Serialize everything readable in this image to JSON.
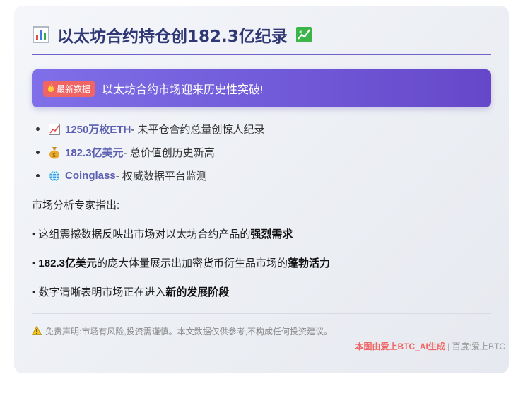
{
  "header": {
    "title": "以太坊合约持仓创182.3亿纪录",
    "left_icon": "bar-chart-icon",
    "right_icon": "chart-up-icon"
  },
  "banner": {
    "badge": "最新数据",
    "badge_icon": "fire-icon",
    "text": "以太坊合约市场迎来历史性突破!"
  },
  "points": [
    {
      "icon": "chart-up-icon",
      "highlight": "1250万枚ETH",
      "desc": " - 未平仓合约总量创惊人纪录"
    },
    {
      "icon": "money-bag-icon",
      "highlight": "182.3亿美元",
      "desc": " - 总价值创历史新高"
    },
    {
      "icon": "globe-icon",
      "highlight": "Coinglass",
      "desc": " - 权威数据平台监测"
    }
  ],
  "analysis": {
    "intro": "市场分析专家指出:",
    "lines": [
      {
        "prefix": "• 这组震撼数据反映出市场对以太坊合约产品的",
        "bold": "强烈需求",
        "suffix": ""
      },
      {
        "prefix": "• ",
        "bold": "182.3亿美元",
        "middle": "的庞大体量展示出加密货币衍生品市场的",
        "bold2": "蓬勃活力"
      },
      {
        "prefix": "• 数字清晰表明市场正在进入",
        "bold": "新的发展阶段",
        "suffix": ""
      }
    ]
  },
  "disclaimer": "免责声明:市场有风险,投资需谨慎。本文数据仅供参考,不构成任何投资建议。",
  "footer": {
    "credit": "本图由爱上BTC_AI生成",
    "separator": " | ",
    "source": "百度:爱上BTC"
  },
  "colors": {
    "title": "#2f3774",
    "accent": "#6f63c9",
    "badge": "#f06563",
    "highlight": "#5b5fb0"
  }
}
